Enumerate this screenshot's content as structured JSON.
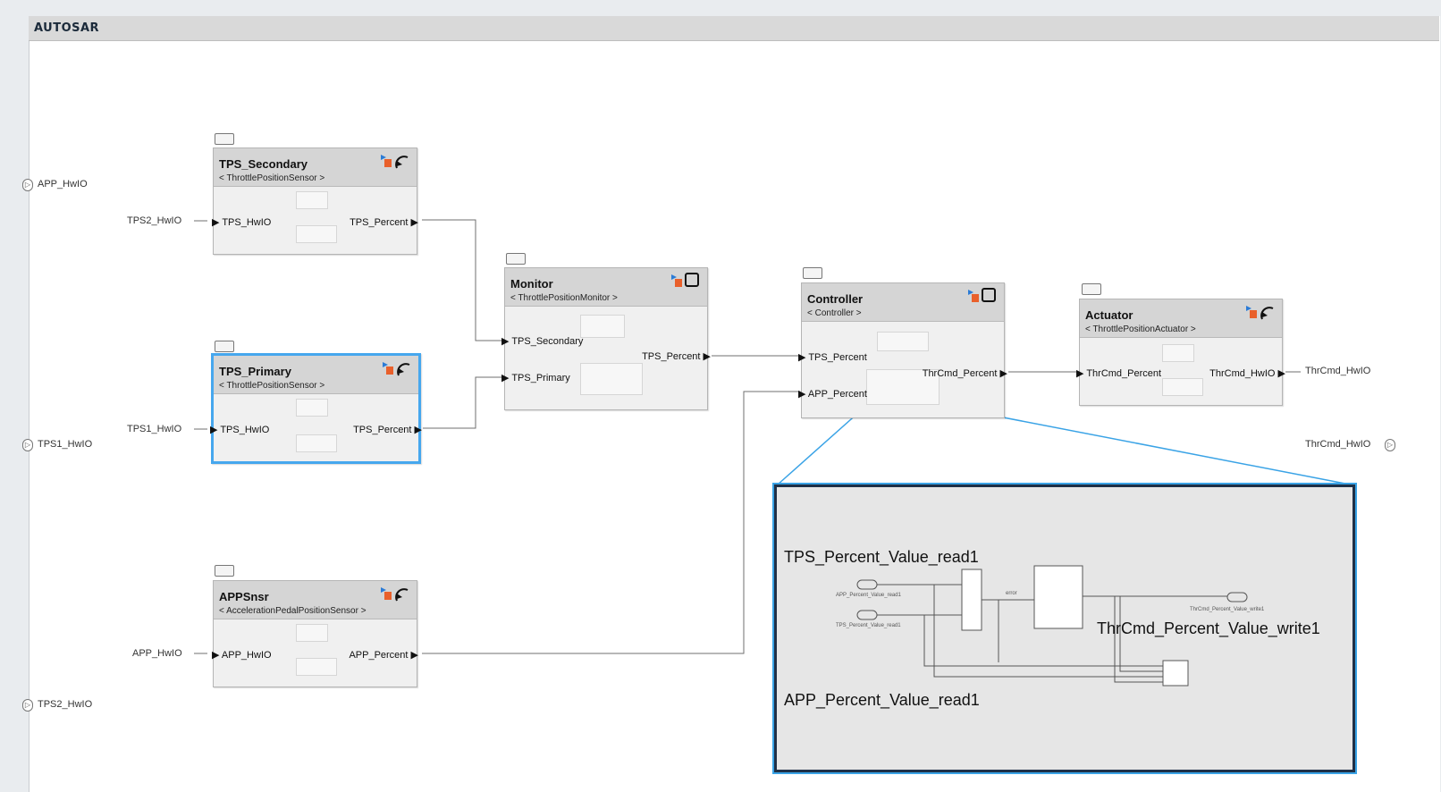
{
  "header": {
    "logo": "AUTOSAR"
  },
  "root_inports": [
    "APP_HwIO",
    "TPS1_HwIO",
    "TPS2_HwIO"
  ],
  "root_outport": "ThrCmd_HwIO",
  "components": {
    "tps_secondary": {
      "name": "TPS_Secondary",
      "type": "< ThrottlePositionSensor >",
      "in_port": "TPS_HwIO",
      "out_port": "TPS_Percent",
      "ext_in": "TPS2_HwIO"
    },
    "tps_primary": {
      "name": "TPS_Primary",
      "type": "< ThrottlePositionSensor >",
      "in_port": "TPS_HwIO",
      "out_port": "TPS_Percent",
      "ext_in": "TPS1_HwIO"
    },
    "appsnsr": {
      "name": "APPSnsr",
      "type": "< AccelerationPedalPositionSensor >",
      "in_port": "APP_HwIO",
      "out_port": "APP_Percent",
      "ext_in": "APP_HwIO"
    },
    "monitor": {
      "name": "Monitor",
      "type": "< ThrottlePositionMonitor >",
      "in_port_1": "TPS_Secondary",
      "in_port_2": "TPS_Primary",
      "out_port": "TPS_Percent"
    },
    "controller": {
      "name": "Controller",
      "type": "< Controller >",
      "in_port_1": "TPS_Percent",
      "in_port_2": "APP_Percent",
      "out_port": "ThrCmd_Percent"
    },
    "actuator": {
      "name": "Actuator",
      "type": "< ThrottlePositionActuator >",
      "in_port": "ThrCmd_Percent",
      "out_port": "ThrCmd_HwIO",
      "ext_out": "ThrCmd_HwIO"
    }
  },
  "inset": {
    "in1_label": "TPS_Percent_Value_read1",
    "in2_label": "APP_Percent_Value_read1",
    "out_label": "ThrCmd_Percent_Value_write1",
    "small_app": "APP_Percent_Value_read1",
    "small_tps": "TPS_Percent_Value_read1",
    "small_error": "error",
    "small_write": "ThrCmd_Percent_Value_write1"
  },
  "colors": {
    "selection": "#46a7ee",
    "zoom_line": "#3aa3e6",
    "wire": "#6f6f6f"
  }
}
